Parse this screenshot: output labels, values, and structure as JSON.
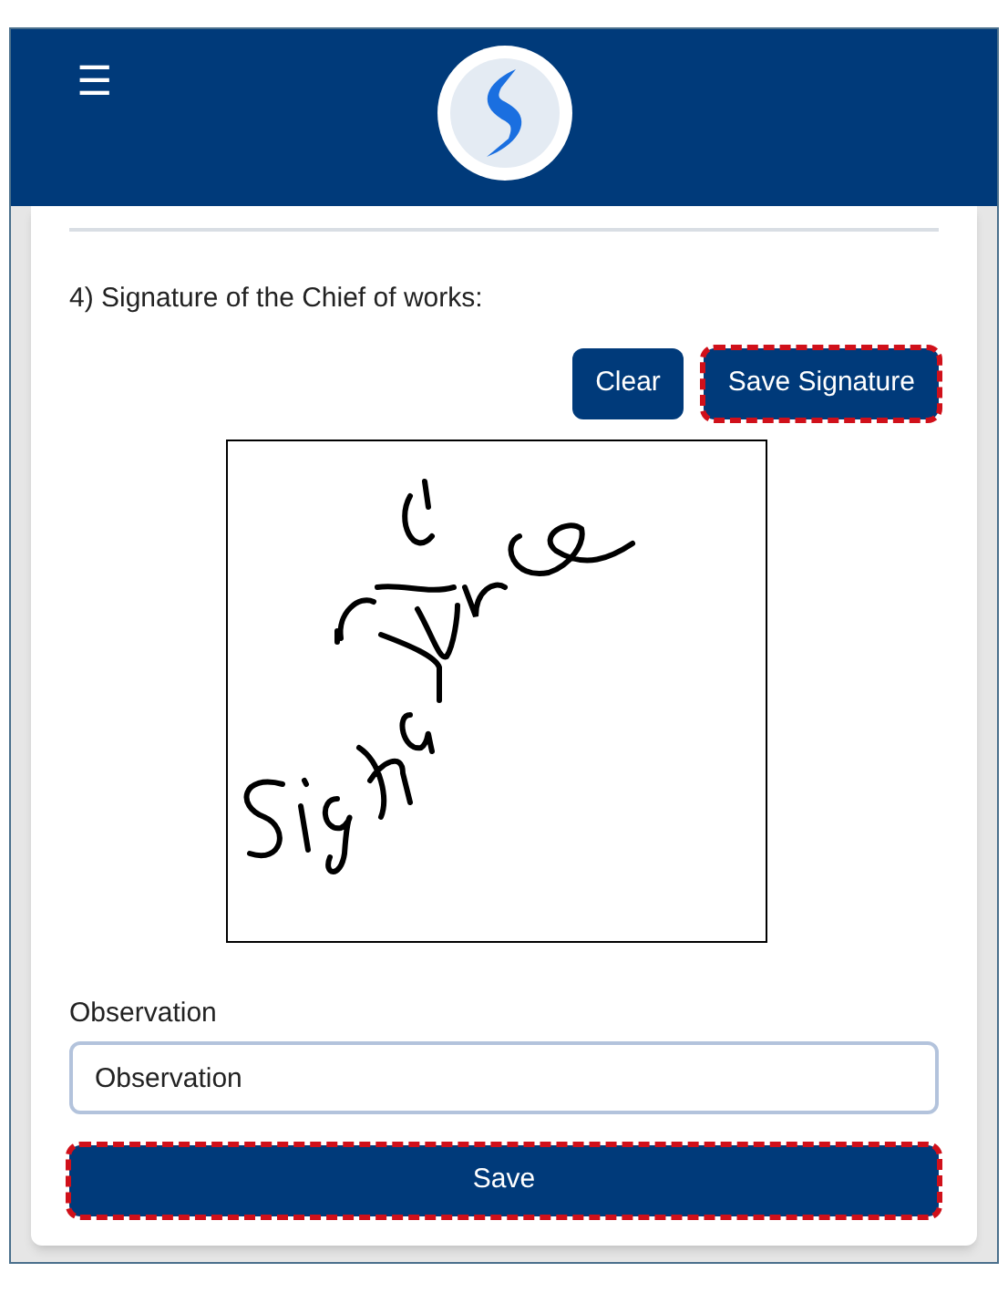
{
  "header": {
    "menu_icon": "☰"
  },
  "section": {
    "title": "4) Signature of the Chief of works:"
  },
  "signature_buttons": [
    {
      "label": "Clear",
      "highlighted": false
    },
    {
      "label": "Save Signature",
      "highlighted": true
    }
  ],
  "observation": {
    "label": "Observation",
    "value": "Observation"
  },
  "save_button": {
    "label": "Save",
    "highlighted": true
  }
}
